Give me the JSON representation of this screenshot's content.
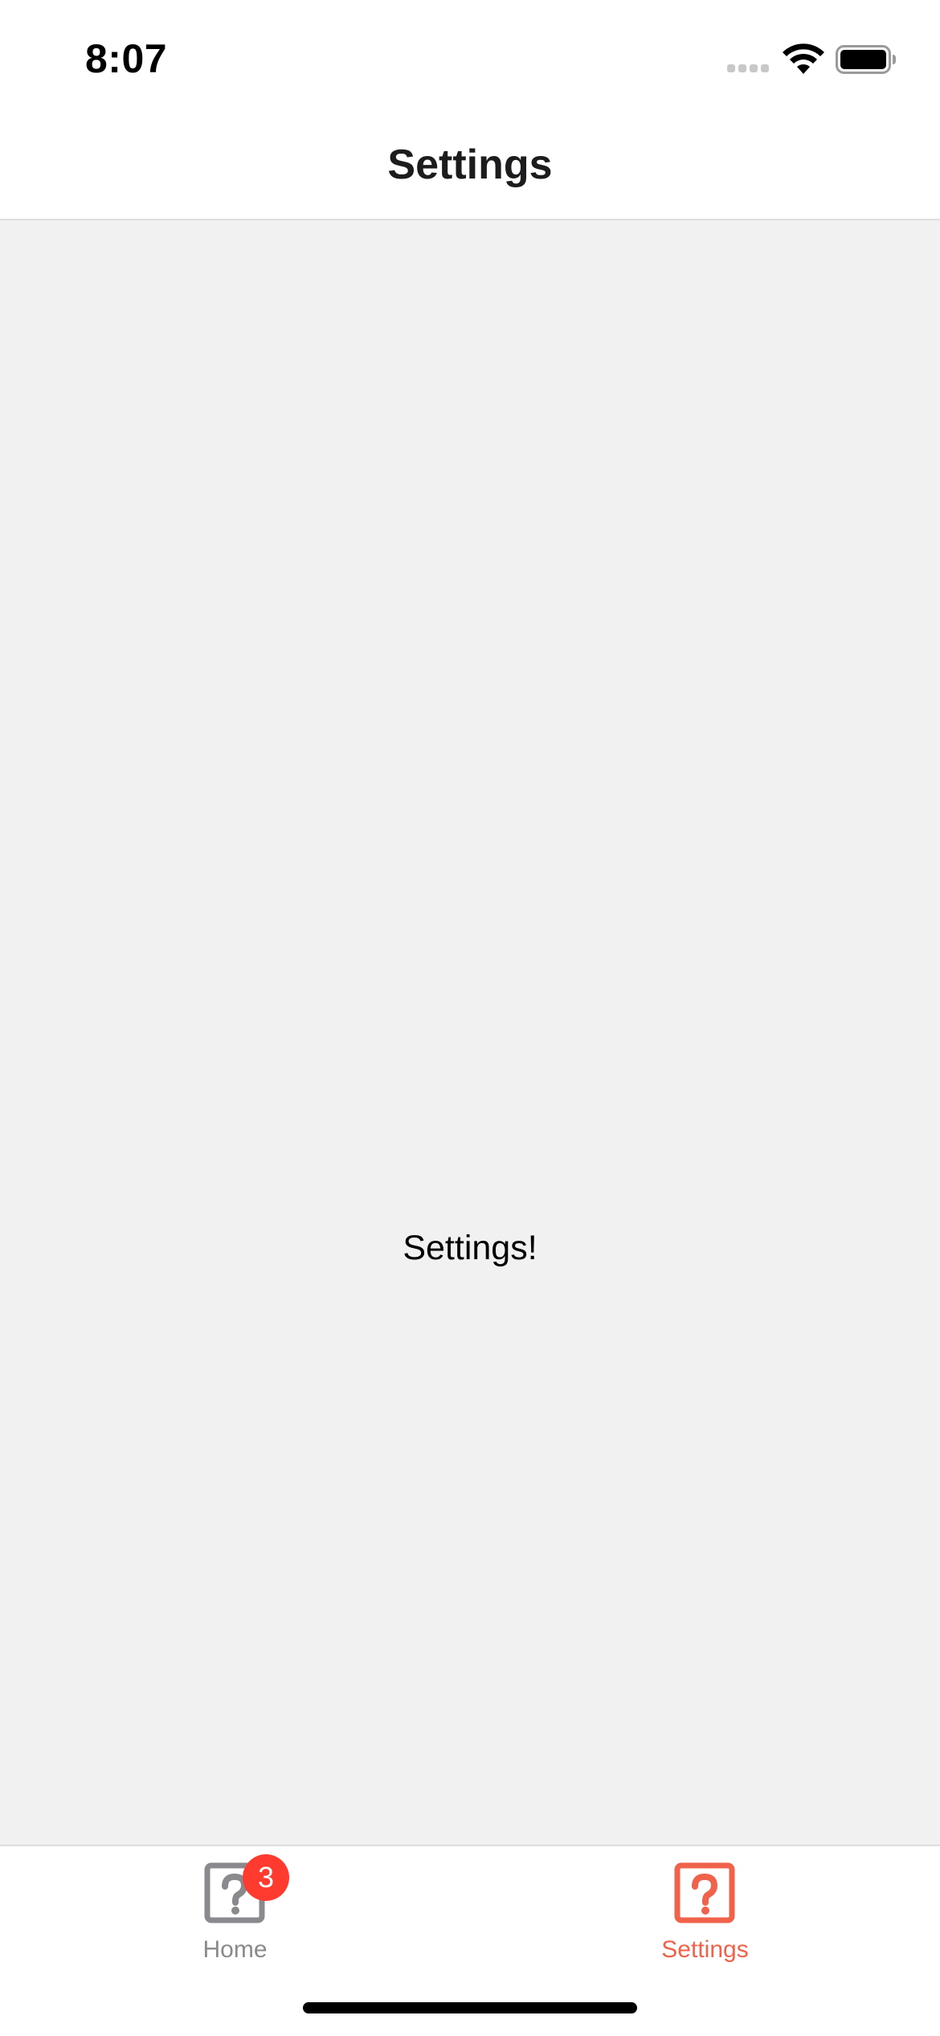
{
  "status_bar": {
    "time": "8:07",
    "icons": [
      "signal-icon",
      "wifi-icon",
      "battery-icon"
    ]
  },
  "header": {
    "title": "Settings"
  },
  "main": {
    "text": "Settings!"
  },
  "tab_bar": {
    "tabs": [
      {
        "label": "Home",
        "icon": "help-box-icon",
        "badge": "3",
        "active": false
      },
      {
        "label": "Settings",
        "icon": "help-box-icon",
        "active": true
      }
    ]
  },
  "colors": {
    "accent": "#f0624a",
    "inactive": "#8a8a8e",
    "badge": "#ff3b30",
    "content_background": "#f1f1f1"
  }
}
